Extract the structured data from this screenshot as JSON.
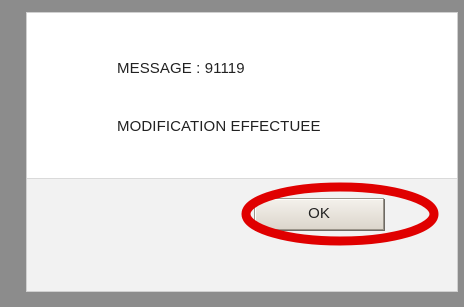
{
  "dialog": {
    "message_code": "MESSAGE : 91119",
    "message_text": "MODIFICATION EFFECTUEE",
    "ok_label": "OK"
  },
  "colors": {
    "highlight": "#e00000",
    "backdrop": "#8c8c8c",
    "footer": "#f2f2f2"
  }
}
